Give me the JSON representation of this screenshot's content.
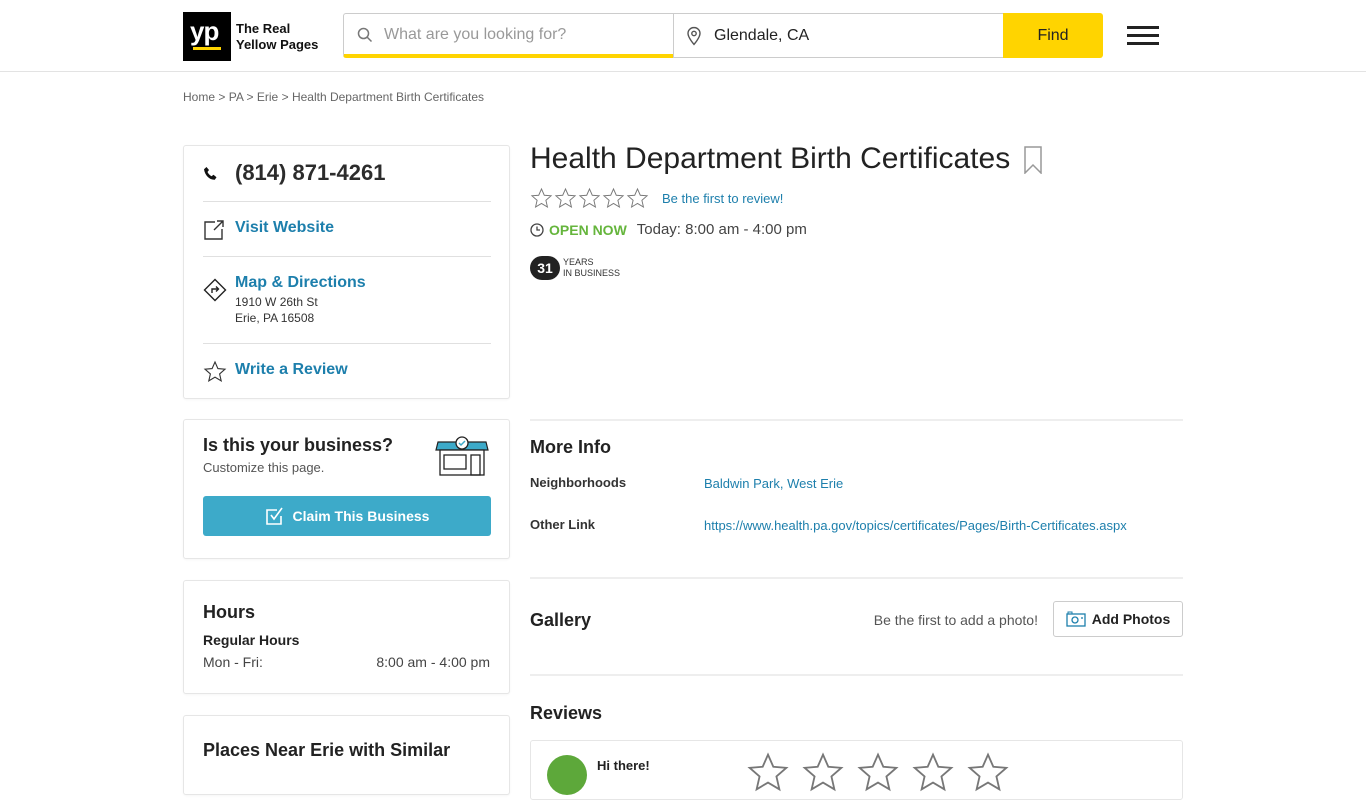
{
  "header": {
    "logo_mark": "yp",
    "logo_text_line1": "The Real",
    "logo_text_line2": "Yellow Pages",
    "search_placeholder": "What are you looking for?",
    "search_value": "",
    "location_value": "Glendale, CA",
    "find_label": "Find"
  },
  "breadcrumb": [
    {
      "label": "Home"
    },
    {
      "label": "PA"
    },
    {
      "label": "Erie"
    },
    {
      "label": "Health Department Birth Certificates"
    }
  ],
  "breadcrumb_sep": ">",
  "contact": {
    "phone": "(814) 871-4261",
    "website_label": "Visit Website",
    "directions_label": "Map & Directions",
    "address_line1": "1910 W 26th St",
    "address_line2": "Erie, PA 16508",
    "review_label": "Write a Review"
  },
  "claim": {
    "title": "Is this your business?",
    "subtitle": "Customize this page.",
    "button_label": "Claim This Business"
  },
  "hours": {
    "title": "Hours",
    "subtitle": "Regular Hours",
    "rows": [
      {
        "day": "Mon - Fri:",
        "time": "8:00 am - 4:00 pm"
      }
    ]
  },
  "places": {
    "title": "Places Near Erie with Similar"
  },
  "business": {
    "name": "Health Department Birth Certificates",
    "rating": 0,
    "rating_max": 5,
    "first_review_label": "Be the first to review!",
    "open_status": "OPEN NOW",
    "today_hours": "Today: 8:00 am - 4:00 pm",
    "years_in_business": "31",
    "years_label_line1": "YEARS",
    "years_label_line2": "IN BUSINESS"
  },
  "more_info": {
    "title": "More Info",
    "rows": [
      {
        "label": "Neighborhoods",
        "value": "Baldwin Park, West Erie"
      },
      {
        "label": "Other Link",
        "value": "https://www.health.pa.gov/topics/certificates/Pages/Birth-Certificates.aspx"
      }
    ]
  },
  "gallery": {
    "title": "Gallery",
    "note": "Be the first to add a photo!",
    "add_label": "Add Photos"
  },
  "reviews": {
    "title": "Reviews",
    "greeting": "Hi there!"
  },
  "colors": {
    "brand_yellow": "#ffd400",
    "link_blue": "#1d7fac",
    "open_green": "#65b53c",
    "claim_blue": "#3daac9"
  }
}
